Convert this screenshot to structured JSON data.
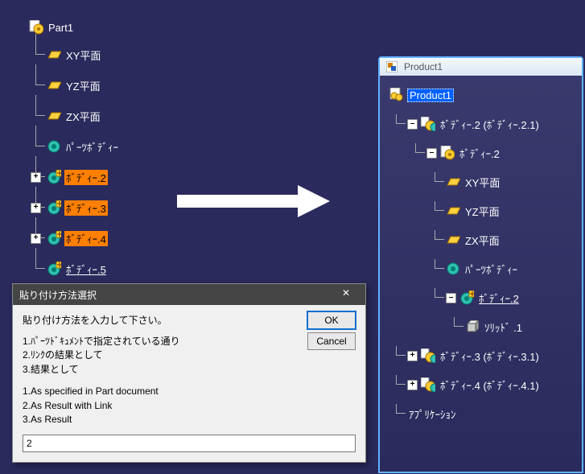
{
  "left_tree": {
    "root": "Part1",
    "nodes": [
      {
        "label": "XY平面",
        "icon": "plane"
      },
      {
        "label": "YZ平面",
        "icon": "plane"
      },
      {
        "label": "ZX平面",
        "icon": "plane"
      },
      {
        "label": "ﾊﾟｰﾂﾎﾞﾃﾞｨｰ",
        "icon": "body"
      },
      {
        "label": "ﾎﾞﾃﾞｨｰ.2",
        "icon": "body-plus",
        "expand": "+",
        "style": "orange"
      },
      {
        "label": "ﾎﾞﾃﾞｨｰ.3",
        "icon": "body-plus",
        "expand": "+",
        "style": "orange"
      },
      {
        "label": "ﾎﾞﾃﾞｨｰ.4",
        "icon": "body-plus",
        "expand": "+",
        "style": "orange"
      },
      {
        "label": "ﾎﾞﾃﾞｨｰ.5",
        "icon": "body-plus",
        "style": "underline"
      }
    ]
  },
  "dialog": {
    "title": "貼り付け方法選択",
    "prompt": "貼り付け方法を入力して下さい。",
    "list_ja": [
      "1.ﾊﾟｰﾂﾄﾞｷｭﾒﾝﾄで指定されている通り",
      "2.ﾘﾝｸの結果として",
      "3.結果として"
    ],
    "list_en": [
      "1.As specified in Part document",
      "2.As Result with Link",
      "3.As Result"
    ],
    "ok": "OK",
    "cancel": "Cancel",
    "input_value": "2"
  },
  "window": {
    "title": "Product1"
  },
  "right_tree": {
    "root": "Product1",
    "nodes": [
      {
        "depth": 1,
        "expand": "-",
        "icon": "product-sub",
        "label": "ﾎﾞﾃﾞｨｰ.2 (ﾎﾞﾃﾞｨｰ.2.1)"
      },
      {
        "depth": 2,
        "expand": "-",
        "icon": "part-gear",
        "label": "ﾎﾞﾃﾞｨｰ.2"
      },
      {
        "depth": 3,
        "icon": "plane",
        "label": "XY平面"
      },
      {
        "depth": 3,
        "icon": "plane",
        "label": "YZ平面"
      },
      {
        "depth": 3,
        "icon": "plane",
        "label": "ZX平面"
      },
      {
        "depth": 3,
        "icon": "body",
        "label": "ﾊﾟｰﾂﾎﾞﾃﾞｨｰ"
      },
      {
        "depth": 3,
        "expand": "-",
        "icon": "body-plus",
        "label": "ﾎﾞﾃﾞｨｰ.2",
        "style": "underline"
      },
      {
        "depth": 4,
        "icon": "solid",
        "label": "ｿﾘｯﾄﾞ .1"
      },
      {
        "depth": 1,
        "expand": "+",
        "icon": "product-sub",
        "label": "ﾎﾞﾃﾞｨｰ.3 (ﾎﾞﾃﾞｨｰ.3.1)"
      },
      {
        "depth": 1,
        "expand": "+",
        "icon": "product-sub",
        "label": "ﾎﾞﾃﾞｨｰ.4 (ﾎﾞﾃﾞｨｰ.4.1)"
      },
      {
        "depth": 1,
        "icon": "none",
        "label": "ｱﾌﾟﾘｹｰｼｮﾝ"
      }
    ]
  }
}
